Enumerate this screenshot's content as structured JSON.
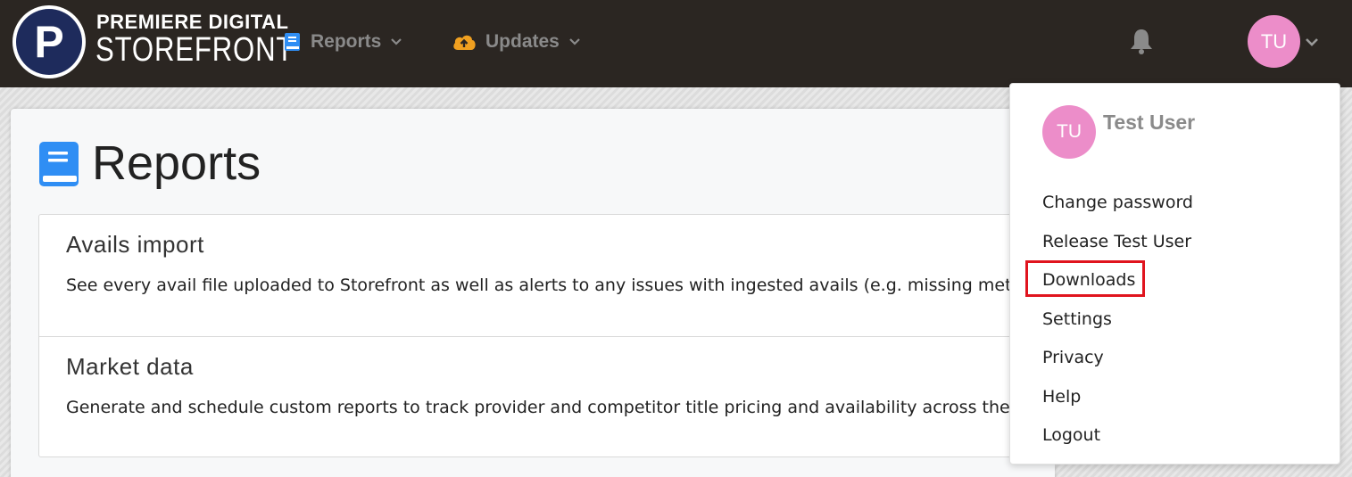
{
  "brand": {
    "logo_letter": "P",
    "line1": "PREMIERE DIGITAL",
    "line2": "STOREFRONT"
  },
  "nav": {
    "items": [
      {
        "label": "Reports",
        "icon": "book-icon",
        "color": "#2f8ef4"
      },
      {
        "label": "Updates",
        "icon": "cloud-upload-icon",
        "color": "#f0a020"
      }
    ]
  },
  "header": {
    "notification_icon": "bell-icon",
    "avatar_initials": "TU"
  },
  "page": {
    "title": "Reports",
    "reports": [
      {
        "title": "Avails import",
        "description": "See every avail file uploaded to Storefront as well as alerts to any issues with ingested avails (e.g. missing metadata"
      },
      {
        "title": "Market data",
        "description": "Generate and schedule custom reports to track provider and competitor title pricing and availability across the dig"
      }
    ]
  },
  "user_menu": {
    "avatar_initials": "TU",
    "name": "Test User",
    "items": [
      {
        "label": "Change password"
      },
      {
        "label": "Release Test User"
      },
      {
        "label": "Downloads",
        "highlighted": true
      },
      {
        "label": "Settings"
      },
      {
        "label": "Privacy"
      },
      {
        "label": "Help"
      },
      {
        "label": "Logout"
      }
    ]
  },
  "colors": {
    "topbar": "#2b2622",
    "avatar": "#ec8dc9",
    "highlight": "#e0141e"
  }
}
